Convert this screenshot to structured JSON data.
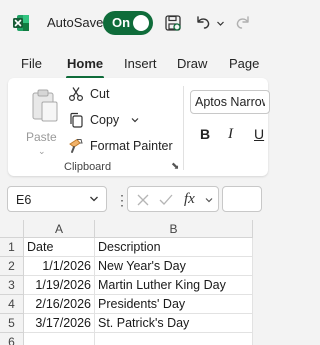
{
  "titlebar": {
    "autosave_label": "AutoSave",
    "autosave_state": "On"
  },
  "tabs": [
    {
      "label": "File"
    },
    {
      "label": "Home",
      "active": true
    },
    {
      "label": "Insert"
    },
    {
      "label": "Draw"
    },
    {
      "label": "Page"
    }
  ],
  "ribbon": {
    "paste_label": "Paste",
    "cut_label": "Cut",
    "copy_label": "Copy",
    "format_painter_label": "Format Painter",
    "group_label": "Clipboard",
    "font_name": "Aptos Narrow",
    "bold_label": "B",
    "italic_label": "I",
    "underline_label": "U"
  },
  "formula_bar": {
    "name_box": "E6",
    "fx_label": "fx",
    "formula": ""
  },
  "sheet": {
    "columns": [
      "A",
      "B"
    ],
    "rows": [
      {
        "num": "1",
        "a": "Date",
        "b": "Description"
      },
      {
        "num": "2",
        "a": "1/1/2026",
        "b": "New Year's Day"
      },
      {
        "num": "3",
        "a": "1/19/2026",
        "b": "Martin Luther King Day"
      },
      {
        "num": "4",
        "a": "2/16/2026",
        "b": "Presidents' Day"
      },
      {
        "num": "5",
        "a": "3/17/2026",
        "b": "St. Patrick's Day"
      },
      {
        "num": "6",
        "a": "",
        "b": ""
      }
    ]
  },
  "colors": {
    "accent": "#0f6c3a",
    "ribbon_bg": "#ffffff",
    "chrome_bg": "#f3f3f3"
  }
}
